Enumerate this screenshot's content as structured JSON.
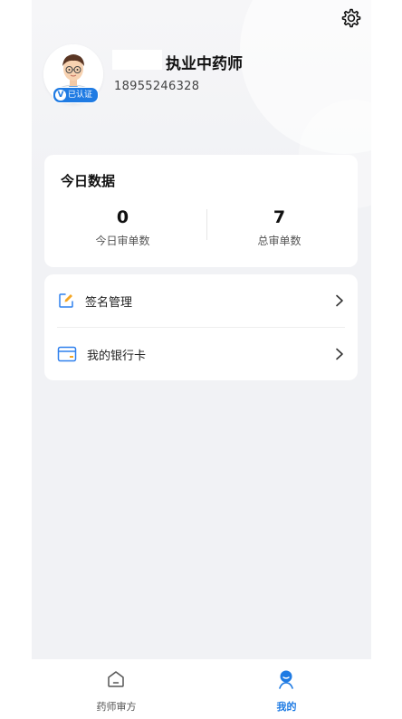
{
  "profile": {
    "title": "执业中药师",
    "phone": "18955246328",
    "verified_badge": "已认证",
    "avatar_icon": "doctor-avatar"
  },
  "settings_icon": "gear-icon",
  "stats": {
    "title": "今日数据",
    "items": [
      {
        "value": "0",
        "label": "今日审单数"
      },
      {
        "value": "7",
        "label": "总审单数"
      }
    ]
  },
  "menu": {
    "items": [
      {
        "label": "签名管理",
        "icon": "edit-signature-icon"
      },
      {
        "label": "我的银行卡",
        "icon": "bank-card-icon"
      }
    ]
  },
  "tabbar": {
    "tabs": [
      {
        "label": "药师审方",
        "icon": "home-icon",
        "active": false
      },
      {
        "label": "我的",
        "icon": "profile-icon",
        "active": true
      }
    ]
  },
  "colors": {
    "accent": "#1f7be3",
    "tab_inactive": "#555555",
    "background": "#f1f2f5"
  }
}
